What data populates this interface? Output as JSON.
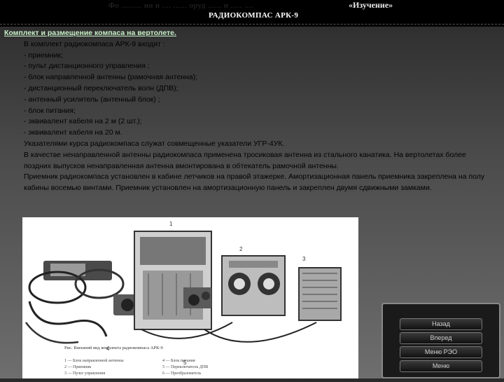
{
  "header": {
    "left_caption": "Фо ......... ии и .... ...... оруд ...... и ..... ....",
    "mode": "«Изучение»",
    "title": "РАДИОКОМПАС АРК-9"
  },
  "content": {
    "section_title": "Комплект и размещение компаса на вертолете.",
    "intro": "В комплект радиокомпаса АРК-9 входят :",
    "items": [
      "- приемник;",
      "- пульт дистанционного управления ;",
      "- блок направленной антенны (рамочная антенна);",
      "- дистанционный переключатель волн (ДПВ);",
      "- антенный усилитель (антенный блок) ;",
      "- блок питания;",
      "- эквивалент кабеля на 2 м (2 шт.);",
      "- эквивалент кабеля на 20 м."
    ],
    "paragraph1": "Указателями курса радиокомпаса служат совмещенные указатели УГР-4УК.",
    "paragraph2": " В качестве ненаправленной антенны радиокомпаса применена тросиковая антенна из стального канатика. На вертолетах более поздних выпусков ненаправленная антенна вмонтирована в обтекатель рамочной антенны.",
    "paragraph3": "Приемник радиокомпаса установлен в кабине летчиков на правой этажерке. Амортизационная панель приемника закреплена на полу кабины восемью винтами. Приемник установлен на амортизационную панель и закреплен двумя сдвижными замками."
  },
  "figure": {
    "caption": "Рис. Внешний вид комплекта радиокомпаса АРК-9",
    "callouts": [
      "1",
      "2",
      "3",
      "4",
      "5"
    ],
    "legend_left": [
      "1 — Блок направленной антенны",
      "2 — Приемник",
      "3 — Пульт управления"
    ],
    "legend_right": [
      "4 — Блок питания",
      "5 — Переключатель ДПВ",
      "6 — Преобразователь"
    ]
  },
  "nav": {
    "buttons": [
      "Назад",
      "Вперед",
      "Меню РЭО",
      "Меню"
    ]
  },
  "colors": {
    "header_bg": "#000000",
    "section_title": "#c8f0c8",
    "body_text": "#000000"
  }
}
